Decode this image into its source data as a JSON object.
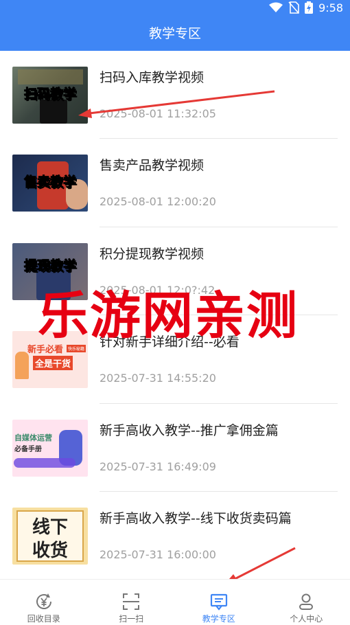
{
  "status_bar": {
    "time": "9:58"
  },
  "header": {
    "title": "教学专区"
  },
  "items": [
    {
      "title": "扫码入库教学视频",
      "time": "2025-08-01 11:32:05",
      "thumb_label": "扫码教学"
    },
    {
      "title": "售卖产品教学视频",
      "time": "2025-08-01 12:00:20",
      "thumb_label": "售卖教学"
    },
    {
      "title": "积分提现教学视频",
      "time": "2025-08-01 12:0?:42",
      "thumb_label": "提现教学"
    },
    {
      "title": "针对新手详细介绍--必看",
      "time": "2025-07-31 14:55:20",
      "thumb_label": "新手必看",
      "thumb_sub": "全是干货",
      "thumb_tag": "快乐秘籍"
    },
    {
      "title": "新手高收入教学--推广拿佣金篇",
      "time": "2025-07-31 16:49:09",
      "thumb_label": "自媒体运营",
      "thumb_sub": "必备手册"
    },
    {
      "title": "新手高收入教学--线下收货卖码篇",
      "time": "2025-07-31 16:00:00",
      "thumb_label": "线下",
      "thumb_sub": "收货"
    }
  ],
  "watermark": "乐游网亲测",
  "tabbar": {
    "items": [
      {
        "label": "回收目录",
        "icon": "yen-recycle-icon"
      },
      {
        "label": "扫一扫",
        "icon": "scan-icon"
      },
      {
        "label": "教学专区",
        "icon": "teaching-board-icon",
        "active": true
      },
      {
        "label": "个人中心",
        "icon": "person-icon"
      }
    ]
  },
  "colors": {
    "accent": "#3f86f5",
    "watermark": "#e60012",
    "arrow": "#e53935"
  }
}
